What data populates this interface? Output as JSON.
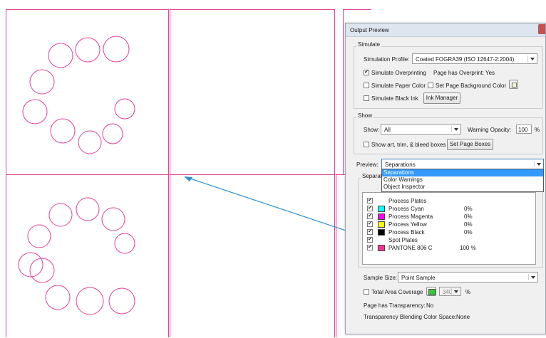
{
  "dialog": {
    "title": "Output Preview",
    "simulate": {
      "group_label": "Simulate",
      "profile_label": "Simulation Profile:",
      "profile_value": "Coated FOGRA39 (ISO 12647-2:2004)",
      "overprint_label": "Simulate Overprinting",
      "overprint_checked": true,
      "page_overprint_label": "Page has Overprint:",
      "page_overprint_value": "Yes",
      "paper_color_label": "Simulate Paper Color",
      "page_bg_label": "Set Page Background Color",
      "black_ink_label": "Simulate Black Ink",
      "ink_manager_label": "Ink Manager"
    },
    "show": {
      "group_label": "Show",
      "show_label": "Show:",
      "show_value": "All",
      "warning_label": "Warning Opacity:",
      "warning_value": "100",
      "percent": "%",
      "boxes_label": "Show art, trim, & bleed boxes",
      "set_boxes_label": "Set Page Boxes"
    },
    "preview": {
      "label": "Preview:",
      "value": "Separations",
      "options": [
        "Separations",
        "Color Warnings",
        "Object Inspector"
      ]
    },
    "separations": {
      "group_label": "Separations",
      "rows": [
        {
          "label": "Process Plates",
          "pct": "",
          "checked": true,
          "swatch": ""
        },
        {
          "label": "Process Cyan",
          "pct": "0%",
          "checked": true,
          "swatch": "#00ffff"
        },
        {
          "label": "Process Magenta",
          "pct": "0%",
          "checked": true,
          "swatch": "#ff00ff"
        },
        {
          "label": "Process Yellow",
          "pct": "0%",
          "checked": true,
          "swatch": "#ffff00"
        },
        {
          "label": "Process Black",
          "pct": "0%",
          "checked": true,
          "swatch": "#000000"
        },
        {
          "label": "Spot Plates",
          "pct": "",
          "checked": true,
          "swatch": ""
        },
        {
          "label": "PANTONE 806 C",
          "pct": "100 %",
          "checked": true,
          "swatch": "#ff3399"
        }
      ]
    },
    "sample": {
      "label": "Sample Size:",
      "value": "Point Sample"
    },
    "coverage": {
      "label": "Total Area Coverage",
      "value": "340",
      "percent": "%",
      "swatch": "#33cc33"
    },
    "transparency_label": "Page has Transparency:",
    "transparency_value": "No",
    "blending_label": "Transparency Blending Color Space:",
    "blending_value": "None"
  },
  "colors": {
    "trim": "#e0409a",
    "arrow": "#2a8fd6",
    "highlight": "#3399ff"
  }
}
